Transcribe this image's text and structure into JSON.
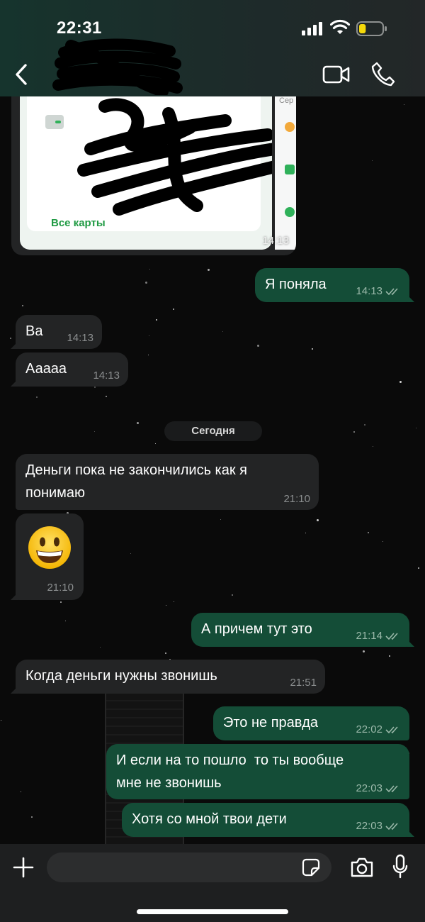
{
  "status_bar": {
    "time": "22:31"
  },
  "header": {
    "back_icon": "chevron-left-icon",
    "video_icon": "video-camera-icon",
    "call_icon": "phone-icon"
  },
  "colors": {
    "outgoing_bubble": "#144d37",
    "incoming_bubble": "#232425",
    "header_bg": "#16342d",
    "battery_level": "#f5d90a"
  },
  "battery": {
    "level_fraction": 0.3
  },
  "messages": {
    "image": {
      "link_text": "Все карты",
      "side_label": "Сер",
      "time": "14:13"
    },
    "m1": {
      "text": "Я поняла",
      "time": "14:13",
      "ticks": "double-check-icon"
    },
    "m2": {
      "text": "Ва",
      "time": "14:13"
    },
    "m3": {
      "text": "Ааааа",
      "time": "14:13"
    },
    "date_separator": "Сегодня",
    "m4": {
      "text": "Деньги пока не закончились как я\nпонимаю",
      "time": "21:10"
    },
    "m5": {
      "emoji": "grinning-face-emoji",
      "time": "21:10"
    },
    "m6": {
      "text": "А причем тут это",
      "time": "21:14"
    },
    "m7": {
      "text": "Когда деньги нужны звонишь",
      "time": "21:51"
    },
    "m8": {
      "text": "Это не правда",
      "time": "22:02"
    },
    "m9": {
      "text": "И если на то пошло  то ты вообще\nмне не звонишь",
      "time": "22:03"
    },
    "m10": {
      "text": "Хотя со мной твои дети",
      "time": "22:03"
    }
  },
  "composer": {
    "placeholder": "",
    "attach_icon": "plus-icon",
    "sticker_icon": "sticker-icon",
    "camera_icon": "camera-icon",
    "mic_icon": "microphone-icon"
  }
}
